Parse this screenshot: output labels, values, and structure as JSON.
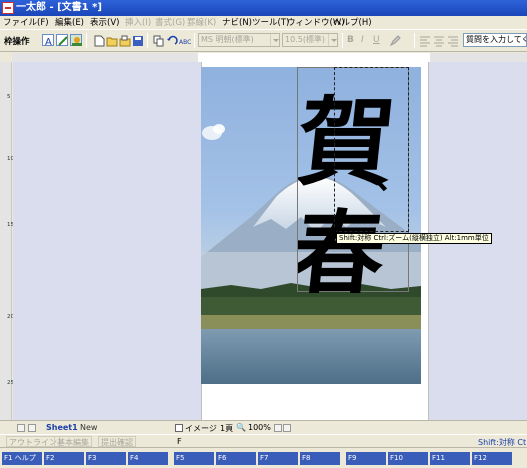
{
  "window": {
    "title": "一太郎 - [文書1 *]"
  },
  "menu": {
    "items": [
      {
        "label": "ファイル(F)",
        "enabled": true
      },
      {
        "label": "編集(E)",
        "enabled": true
      },
      {
        "label": "表示(V)",
        "enabled": true
      },
      {
        "label": "挿入(I)",
        "enabled": false
      },
      {
        "label": "書式(G)",
        "enabled": false
      },
      {
        "label": "罫線(K)",
        "enabled": false
      },
      {
        "label": "ナビ(N)",
        "enabled": true
      },
      {
        "label": "ツール(T)",
        "enabled": true
      },
      {
        "label": "ウィンドウ(W)",
        "enabled": true
      },
      {
        "label": "ヘルプ(H)",
        "enabled": true
      }
    ]
  },
  "toolbar": {
    "mode_label": "枠操作",
    "font_name": "MS 明朝(標準)",
    "font_size": "10.5(標準)",
    "bold": "B",
    "italic": "I",
    "underline": "U",
    "question_placeholder": "質問を入力してくださ"
  },
  "ruler": {
    "vertical_marks": [
      "5",
      "10",
      "15",
      "20",
      "25"
    ]
  },
  "canvas": {
    "calligraphy": {
      "char1": "賀",
      "mark": "、",
      "char2": "春"
    },
    "tooltip": "Shift:対称 Ctrl:ズーム(縦横独立) Alt:1mm単位"
  },
  "bottombar": {
    "sheet_tab": "Sheet1",
    "new_tab": "New",
    "image_label": "イメージ",
    "page_label": "1頁",
    "zoom": "100%"
  },
  "modes": {
    "tabs": [
      "アウトライン",
      "基本編集",
      "提出確認"
    ],
    "f_label": "F"
  },
  "status": {
    "hint": "Shift:対称 Ct"
  },
  "fkeys": {
    "f1": "F1 ヘルプ",
    "others": [
      "F2",
      "F3",
      "F4",
      "F5",
      "F6",
      "F7",
      "F8",
      "F9",
      "F10",
      "F11",
      "F12"
    ]
  },
  "colors": {
    "titlebar": "#2456C8",
    "workspace": "#DADDEE",
    "sky": "#9DBDE5",
    "lake": "#5E7F96"
  }
}
